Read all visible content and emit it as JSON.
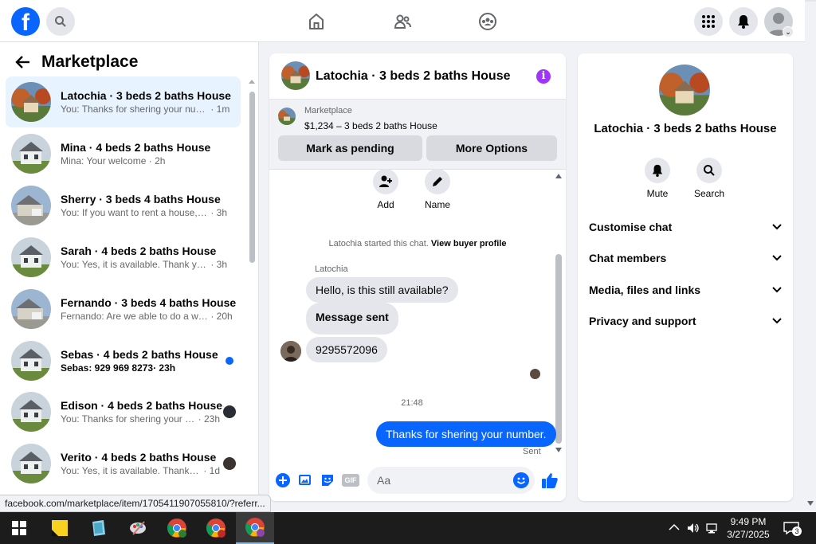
{
  "topbar": {
    "logo": "f",
    "icons": [
      "search-icon",
      "home-icon",
      "friends-icon",
      "groups-icon",
      "menu-grid-icon",
      "notifications-icon",
      "account-icon"
    ]
  },
  "sidebar": {
    "title": "Marketplace",
    "conversations": [
      {
        "name": "Latochia · 3 beds 2 baths House",
        "preview": "You: Thanks for shering your num...",
        "time": "· 1m",
        "active": true
      },
      {
        "name": "Mina · 4 beds 2 baths House",
        "preview": "Mina: Your welcome",
        "time": "· 2h"
      },
      {
        "name": "Sherry · 3 beds 4 baths House",
        "preview": "You: If you want to rent a house, pl...",
        "time": "· 3h"
      },
      {
        "name": "Sarah · 4 beds 2 baths House",
        "preview": "You: Yes, it is available. Thank you f...",
        "time": "· 3h"
      },
      {
        "name": "Fernando · 3 beds 4 baths House",
        "preview": "Fernando: Are we able to do a wa...",
        "time": "· 20h"
      },
      {
        "name": "Sebas · 4 beds 2 baths House",
        "preview": "Sebas: 929 969 8273",
        "time": "· 23h",
        "unread": true
      },
      {
        "name": "Edison · 4 beds 2 baths House",
        "preview": "You: Thanks for shering your n...",
        "time": "· 23h"
      },
      {
        "name": "Verito · 4 beds 2 baths House",
        "preview": "You: Yes, it is available. Thank yo...",
        "time": "· 1d"
      }
    ]
  },
  "chat": {
    "title": "Latochia · 3 beds 2 baths House",
    "listing": {
      "kicker": "Marketplace",
      "title": "$1,234 – 3 beds 2 baths House",
      "mark_pending": "Mark as pending",
      "more_options": "More Options"
    },
    "quick_actions": {
      "add": "Add",
      "name": "Name"
    },
    "system_message": "Latochia started this chat.",
    "view_profile": "View buyer profile",
    "sender": "Latochia",
    "messages": {
      "m1": "Hello, is this still available?",
      "m2": "Message sent",
      "m3": "9295572096",
      "time": "21:48",
      "m4": "Thanks for shering your number.",
      "status": "Sent"
    },
    "composer": {
      "placeholder": "Aa",
      "gif": "GIF"
    }
  },
  "details": {
    "title": "Latochia · 3 beds 2 baths House",
    "mute": "Mute",
    "search": "Search",
    "sections": [
      "Customise chat",
      "Chat members",
      "Media, files and links",
      "Privacy and support"
    ]
  },
  "status_url": "facebook.com/marketplace/item/1705411907055810/?referr...",
  "taskbar": {
    "time": "9:49 PM",
    "date": "3/27/2025",
    "notifications": "3"
  },
  "colors": {
    "brand": "#0866ff",
    "accent_info": "#a033ff",
    "active_row": "#e7f3ff"
  }
}
